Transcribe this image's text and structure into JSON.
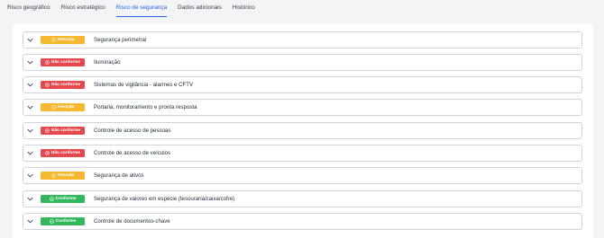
{
  "tabs": [
    {
      "label": "Risco geográfico"
    },
    {
      "label": "Risco estratégico"
    },
    {
      "label": "Risco de segurança"
    },
    {
      "label": "Dados adicionais"
    },
    {
      "label": "Histórico"
    }
  ],
  "active_tab": "Risco de segurança",
  "status_labels": {
    "warn": "Atenção",
    "fail": "Não conforme",
    "ok": "Conforme"
  },
  "colors": {
    "warn": "#f5b82e",
    "fail": "#e5484d",
    "ok": "#34b85c",
    "accent": "#2563eb"
  },
  "items": [
    {
      "status": "warn",
      "label": "Segurança perimetral"
    },
    {
      "status": "fail",
      "label": "Iluminação"
    },
    {
      "status": "fail",
      "label": "Sistemas de vigilância - alarmes e CFTV"
    },
    {
      "status": "warn",
      "label": "Portaria, monitoramento e pronta resposta"
    },
    {
      "status": "fail",
      "label": "Controle de acesso de pessoas"
    },
    {
      "status": "fail",
      "label": "Controle de acesso de veículos"
    },
    {
      "status": "warn",
      "label": "Segurança de ativos"
    },
    {
      "status": "ok",
      "label": "Segurança de valores em espécie (tesouraria/caixa/cofre)"
    },
    {
      "status": "ok",
      "label": "Controle de documentos-chave"
    }
  ]
}
